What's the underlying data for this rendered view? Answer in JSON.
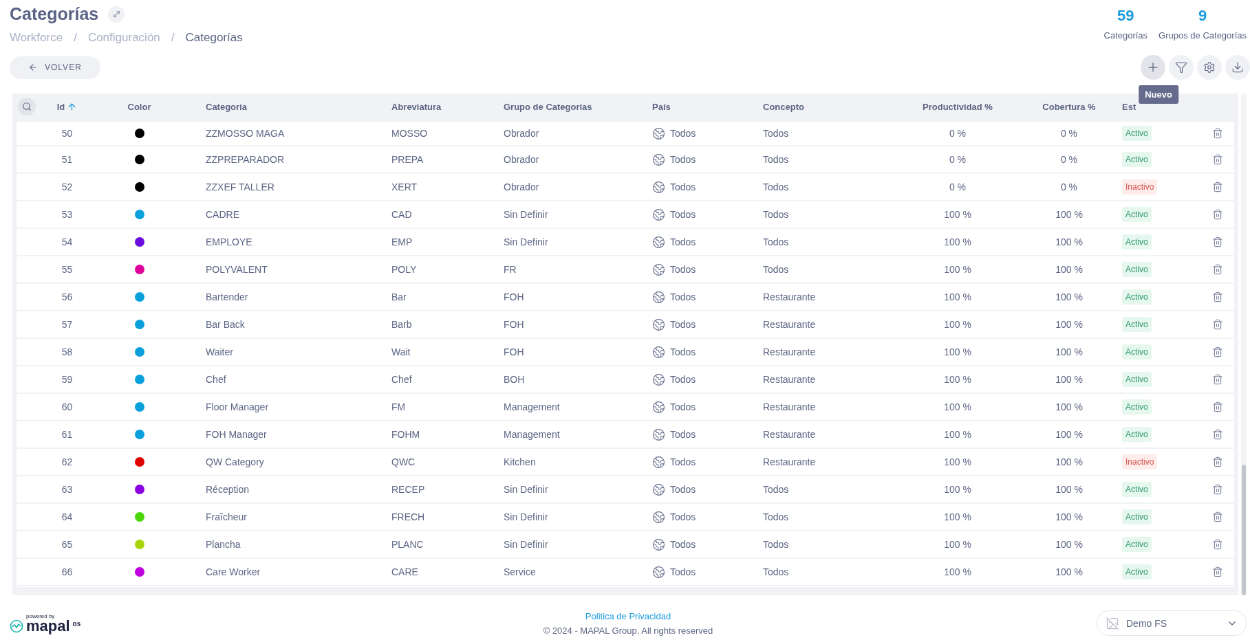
{
  "header": {
    "title": "Categorías",
    "breadcrumb": [
      "Workforce",
      "Configuración",
      "Categorías"
    ],
    "separator": "/"
  },
  "stats": [
    {
      "value": "59",
      "label": "Categorías"
    },
    {
      "value": "9",
      "label": "Grupos de Categorías"
    }
  ],
  "back_button": {
    "label": "VOLVER"
  },
  "tooltip": {
    "label": "Nuevo"
  },
  "table": {
    "columns": [
      {
        "label": "Id",
        "sorted": true
      },
      {
        "label": "Color",
        "sorted": false
      },
      {
        "label": "Categoría",
        "sorted": false
      },
      {
        "label": "Abreviatura",
        "sorted": false
      },
      {
        "label": "Grupo de Categorías",
        "sorted": false
      },
      {
        "label": "País",
        "sorted": false
      },
      {
        "label": "Concepto",
        "sorted": false
      },
      {
        "label": "Productividad %",
        "sorted": false
      },
      {
        "label": "Cobertura %",
        "sorted": false
      },
      {
        "label": "Est",
        "sorted": false
      }
    ],
    "rows": [
      {
        "id": "50",
        "color": "#000000",
        "name": "ZZMOSSO MAGA",
        "abbr": "MOSSO",
        "group": "Obrador",
        "country": "Todos",
        "concept": "Todos",
        "productivity": "0 %",
        "coverage": "0 %",
        "status": "Activo",
        "active": true
      },
      {
        "id": "51",
        "color": "#000000",
        "name": "ZZPREPARADOR",
        "abbr": "PREPA",
        "group": "Obrador",
        "country": "Todos",
        "concept": "Todos",
        "productivity": "0 %",
        "coverage": "0 %",
        "status": "Activo",
        "active": true
      },
      {
        "id": "52",
        "color": "#000000",
        "name": "ZZXEF TALLER",
        "abbr": "XERT",
        "group": "Obrador",
        "country": "Todos",
        "concept": "Todos",
        "productivity": "0 %",
        "coverage": "0 %",
        "status": "Inactivo",
        "active": false
      },
      {
        "id": "53",
        "color": "#0aa0dc",
        "name": "CADRE",
        "abbr": "CAD",
        "group": "Sin Definir",
        "country": "Todos",
        "concept": "Todos",
        "productivity": "100 %",
        "coverage": "100 %",
        "status": "Activo",
        "active": true
      },
      {
        "id": "54",
        "color": "#6a0ddd",
        "name": "EMPLOYE",
        "abbr": "EMP",
        "group": "Sin Definir",
        "country": "Todos",
        "concept": "Todos",
        "productivity": "100 %",
        "coverage": "100 %",
        "status": "Activo",
        "active": true
      },
      {
        "id": "55",
        "color": "#e0009a",
        "name": "POLYVALENT",
        "abbr": "POLY",
        "group": "FR",
        "country": "Todos",
        "concept": "Todos",
        "productivity": "100 %",
        "coverage": "100 %",
        "status": "Activo",
        "active": true
      },
      {
        "id": "56",
        "color": "#0aa0dc",
        "name": "Bartender",
        "abbr": "Bar",
        "group": "FOH",
        "country": "Todos",
        "concept": "Restaurante",
        "productivity": "100 %",
        "coverage": "100 %",
        "status": "Activo",
        "active": true
      },
      {
        "id": "57",
        "color": "#0aa0dc",
        "name": "Bar Back",
        "abbr": "Barb",
        "group": "FOH",
        "country": "Todos",
        "concept": "Restaurante",
        "productivity": "100 %",
        "coverage": "100 %",
        "status": "Activo",
        "active": true
      },
      {
        "id": "58",
        "color": "#0aa0dc",
        "name": "Waiter",
        "abbr": "Wait",
        "group": "FOH",
        "country": "Todos",
        "concept": "Restaurante",
        "productivity": "100 %",
        "coverage": "100 %",
        "status": "Activo",
        "active": true
      },
      {
        "id": "59",
        "color": "#0aa0dc",
        "name": "Chef",
        "abbr": "Chef",
        "group": "BOH",
        "country": "Todos",
        "concept": "Restaurante",
        "productivity": "100 %",
        "coverage": "100 %",
        "status": "Activo",
        "active": true
      },
      {
        "id": "60",
        "color": "#0aa0dc",
        "name": "Floor Manager",
        "abbr": "FM",
        "group": "Management",
        "country": "Todos",
        "concept": "Restaurante",
        "productivity": "100 %",
        "coverage": "100 %",
        "status": "Activo",
        "active": true
      },
      {
        "id": "61",
        "color": "#0aa0dc",
        "name": "FOH Manager",
        "abbr": "FOHM",
        "group": "Management",
        "country": "Todos",
        "concept": "Restaurante",
        "productivity": "100 %",
        "coverage": "100 %",
        "status": "Activo",
        "active": true
      },
      {
        "id": "62",
        "color": "#e00000",
        "name": "QW Category",
        "abbr": "QWC",
        "group": "Kitchen",
        "country": "Todos",
        "concept": "Restaurante",
        "productivity": "100 %",
        "coverage": "100 %",
        "status": "Inactivo",
        "active": false
      },
      {
        "id": "63",
        "color": "#8a00e0",
        "name": "Réception",
        "abbr": "RECEP",
        "group": "Sin Definir",
        "country": "Todos",
        "concept": "Todos",
        "productivity": "100 %",
        "coverage": "100 %",
        "status": "Activo",
        "active": true
      },
      {
        "id": "64",
        "color": "#4cd60a",
        "name": "Fraîcheur",
        "abbr": "FRECH",
        "group": "Sin Definir",
        "country": "Todos",
        "concept": "Todos",
        "productivity": "100 %",
        "coverage": "100 %",
        "status": "Activo",
        "active": true
      },
      {
        "id": "65",
        "color": "#a9d60a",
        "name": "Plancha",
        "abbr": "PLANC",
        "group": "Sin Definir",
        "country": "Todos",
        "concept": "Todos",
        "productivity": "100 %",
        "coverage": "100 %",
        "status": "Activo",
        "active": true
      },
      {
        "id": "66",
        "color": "#c000e0",
        "name": "Care Worker",
        "abbr": "CARE",
        "group": "Service",
        "country": "Todos",
        "concept": "Todos",
        "productivity": "100 %",
        "coverage": "100 %",
        "status": "Activo",
        "active": true
      }
    ]
  },
  "footer": {
    "logo": {
      "tagline": "powered by",
      "name": "mapal",
      "suffix": "os"
    },
    "privacy_link": "Politica de Privacidad",
    "copyright": "© 2024 - MAPAL Group. All rights reserved",
    "account_select": "Demo FS"
  }
}
